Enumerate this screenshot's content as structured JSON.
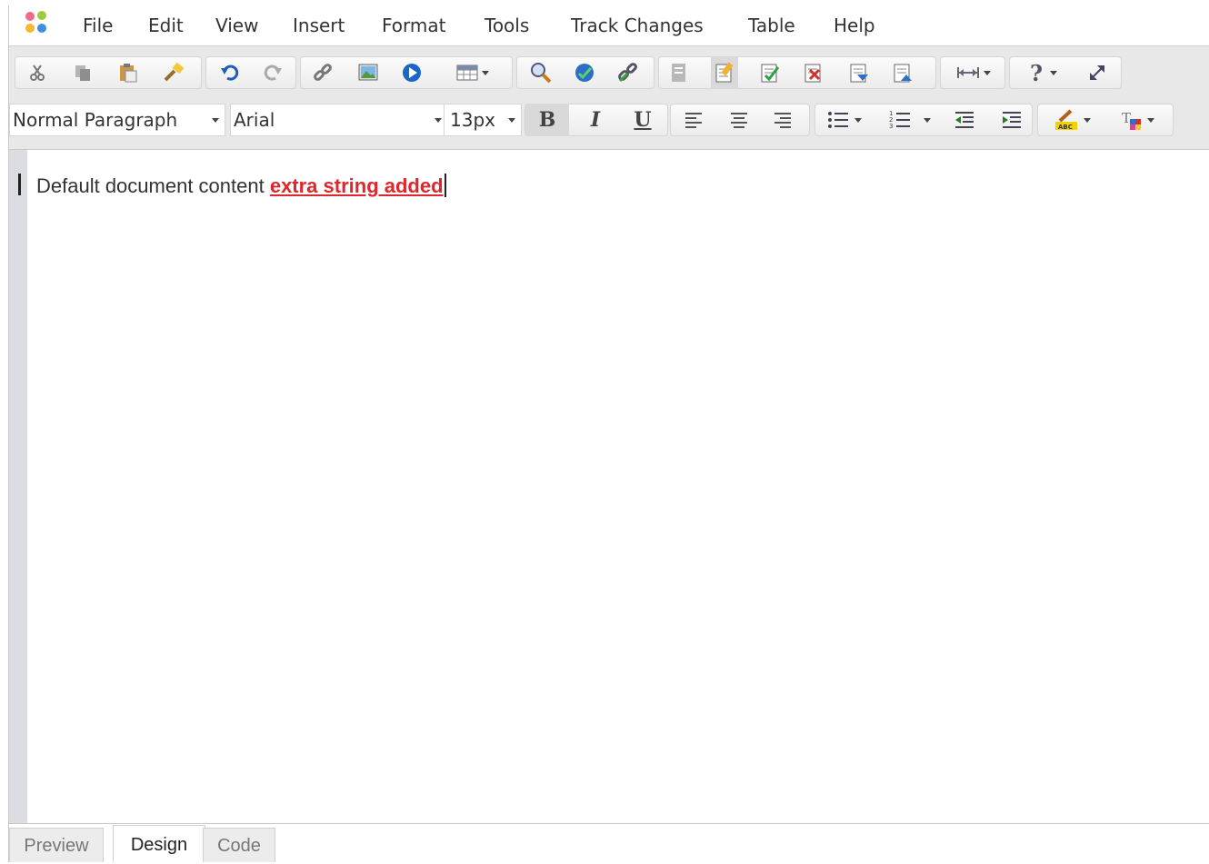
{
  "menubar": {
    "items": [
      "File",
      "Edit",
      "View",
      "Insert",
      "Format",
      "Tools",
      "Track Changes",
      "Table",
      "Help"
    ]
  },
  "toolbar1": {
    "groups": [
      [
        "cut-icon",
        "copy-icon",
        "paste-icon",
        "format-painter-icon"
      ],
      [
        "undo-icon",
        "redo-icon"
      ],
      [
        "link-icon",
        "image-icon",
        "media-icon",
        "table-icon"
      ],
      [
        "find-icon",
        "spellcheck-icon",
        "unlink-icon"
      ],
      [
        "document-icon",
        "track-changes-icon",
        "accept-change-icon",
        "reject-change-icon",
        "next-change-icon",
        "previous-change-icon"
      ],
      [
        "horizontal-rule-icon"
      ],
      [
        "help-icon",
        "fullscreen-icon"
      ]
    ]
  },
  "toolbar2": {
    "paragraph_style": "Normal Paragraph",
    "font_family": "Arial",
    "font_size": "13px",
    "bold": "B",
    "italic": "I",
    "underline": "U"
  },
  "document": {
    "text": "Default document content ",
    "inserted_text": "extra string added"
  },
  "colors": {
    "inserted_text": "#e0262b",
    "gutter": "#dcdde2",
    "toolbar_bg": "#e8e8e8"
  },
  "tabs": {
    "preview": "Preview",
    "design": "Design",
    "code": "Code",
    "active": "Design"
  }
}
